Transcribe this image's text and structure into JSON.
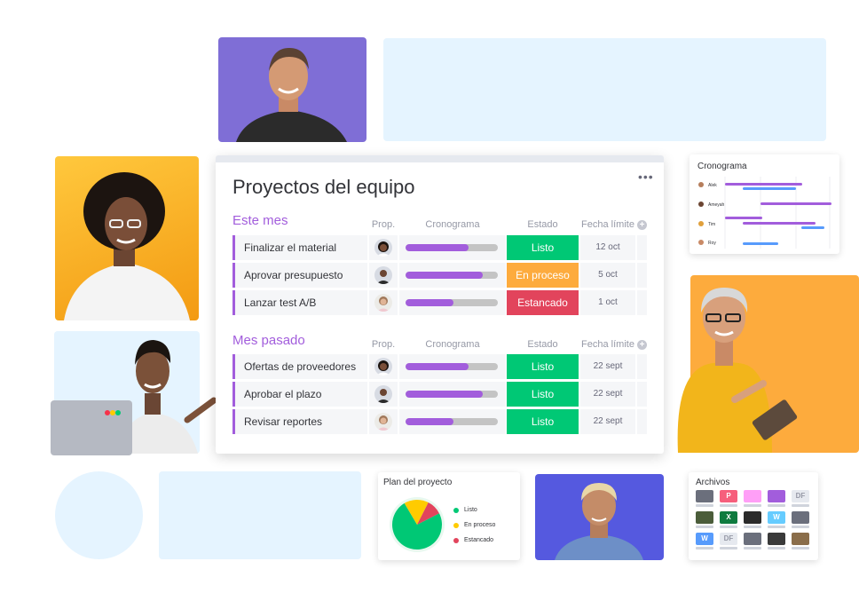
{
  "board": {
    "title": "Proyectos del equipo",
    "menu_icon": "more-dots-icon",
    "columns": {
      "owner": "Prop.",
      "timeline": "Cronograma",
      "status": "Estado",
      "date": "Fecha límite"
    },
    "groups": [
      {
        "title": "Este mes",
        "rows": [
          {
            "name": "Finalizar el material",
            "progress": 0.68,
            "status": "Listo",
            "status_color": "#00c875",
            "date": "12 oct"
          },
          {
            "name": "Aprovar presupuesto",
            "progress": 0.84,
            "status": "En proceso",
            "status_color": "#fdab3d",
            "date": "5 oct"
          },
          {
            "name": "Lanzar test A/B",
            "progress": 0.52,
            "status": "Estancado",
            "status_color": "#e2445c",
            "date": "1 oct"
          }
        ]
      },
      {
        "title": "Mes pasado",
        "rows": [
          {
            "name": "Ofertas de proveedores",
            "progress": 0.68,
            "status": "Listo",
            "status_color": "#00c875",
            "date": "22 sept"
          },
          {
            "name": "Aprobar el plazo",
            "progress": 0.84,
            "status": "Listo",
            "status_color": "#00c875",
            "date": "22 sept"
          },
          {
            "name": "Revisar reportes",
            "progress": 0.52,
            "status": "Listo",
            "status_color": "#00c875",
            "date": "22 sept"
          }
        ]
      }
    ]
  },
  "gantt_card": {
    "title": "Cronograma",
    "people": [
      "Alek",
      "Ameyah",
      "Tim",
      "Roy"
    ]
  },
  "plan_card": {
    "title": "Plan del proyecto",
    "legend": [
      {
        "label": "Listo",
        "color": "#00c875"
      },
      {
        "label": "En proceso",
        "color": "#ffcb00"
      },
      {
        "label": "Estancado",
        "color": "#e2445c"
      }
    ],
    "shares": [
      0.74,
      0.16,
      0.1
    ]
  },
  "files_card": {
    "title": "Archivos",
    "files": [
      {
        "icon": "pdf-icon",
        "glyph": "",
        "color": "#6b6f7c"
      },
      {
        "icon": "powerpoint-icon",
        "glyph": "P",
        "color": "#f65f7c"
      },
      {
        "icon": "audio-icon",
        "glyph": "",
        "color": "#ff9ff7"
      },
      {
        "icon": "video-icon",
        "glyph": "",
        "color": "#a25ddc"
      },
      {
        "icon": "generic-file-icon",
        "glyph": "DF",
        "color": "#e6e9ef"
      },
      {
        "icon": "image-thumbnail-icon",
        "glyph": "",
        "color": "#4b5d3a"
      },
      {
        "icon": "excel-icon",
        "glyph": "X",
        "color": "#0f7b3f"
      },
      {
        "icon": "photo-thumbnail-icon",
        "glyph": "",
        "color": "#2b2b2b"
      },
      {
        "icon": "word-icon",
        "glyph": "W",
        "color": "#66ccff"
      },
      {
        "icon": "pdf-icon",
        "glyph": "",
        "color": "#6b6f7c"
      },
      {
        "icon": "word-icon",
        "glyph": "W",
        "color": "#579bfc"
      },
      {
        "icon": "generic-file-icon",
        "glyph": "DF",
        "color": "#e6e9ef"
      },
      {
        "icon": "pdf-icon",
        "glyph": "",
        "color": "#6b6f7c"
      },
      {
        "icon": "image-thumbnail-icon",
        "glyph": "",
        "color": "#3a3a3a"
      },
      {
        "icon": "image-thumbnail-icon",
        "glyph": "",
        "color": "#8a6d4a"
      }
    ]
  },
  "colors": {
    "accent_purple": "#a25ddc",
    "light_blue": "#e5f4ff",
    "tile_purple": "#7f6ed6",
    "tile_indigo": "#5559df",
    "tile_orange": "#fdab3d",
    "tile_yellow": "#ffc83d"
  }
}
